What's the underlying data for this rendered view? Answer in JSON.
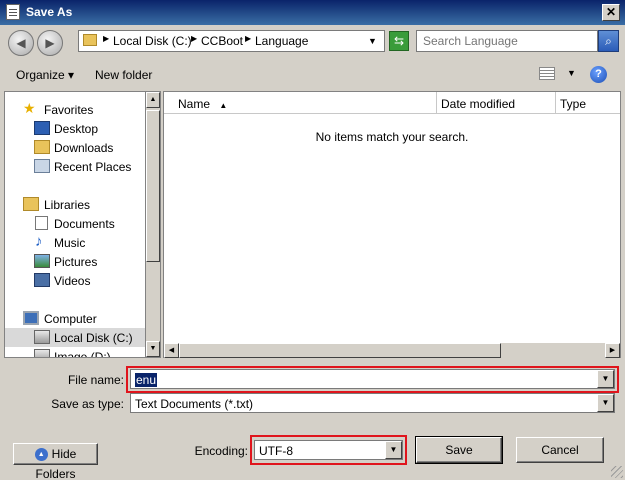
{
  "window": {
    "title": "Save As",
    "close_glyph": "✕"
  },
  "address": {
    "crumbs": [
      "Local Disk (C:)",
      "CCBoot",
      "Language"
    ],
    "search_placeholder": "Search Language"
  },
  "toolbar": {
    "organize_label": "Organize ▾",
    "new_folder_label": "New folder",
    "help_glyph": "?"
  },
  "nav": {
    "items": [
      {
        "label": "Favorites",
        "icon": "star-icon"
      },
      {
        "label": "Desktop",
        "icon": "desktop-icon"
      },
      {
        "label": "Downloads",
        "icon": "downloads-icon"
      },
      {
        "label": "Recent Places",
        "icon": "recent-places-icon"
      },
      {
        "label": "Libraries",
        "icon": "libraries-icon"
      },
      {
        "label": "Documents",
        "icon": "documents-icon"
      },
      {
        "label": "Music",
        "icon": "music-icon"
      },
      {
        "label": "Pictures",
        "icon": "pictures-icon"
      },
      {
        "label": "Videos",
        "icon": "videos-icon"
      },
      {
        "label": "Computer",
        "icon": "computer-icon"
      },
      {
        "label": "Local Disk (C:)",
        "icon": "drive-icon",
        "selected": true
      },
      {
        "label": "Image (D:)",
        "icon": "drive-icon"
      }
    ]
  },
  "filelist": {
    "columns": [
      "Name",
      "Date modified",
      "Type"
    ],
    "empty_message": "No items match your search."
  },
  "form": {
    "filename_label": "File name:",
    "filename_value": "enu",
    "savetype_label": "Save as type:",
    "savetype_value": "Text Documents (*.txt)",
    "encoding_label": "Encoding:",
    "encoding_value": "UTF-8"
  },
  "buttons": {
    "hide_folders": "Hide Folders",
    "save": "Save",
    "cancel": "Cancel"
  },
  "colors": {
    "highlight_border": "#e0141c",
    "selection": "#0a246a"
  }
}
